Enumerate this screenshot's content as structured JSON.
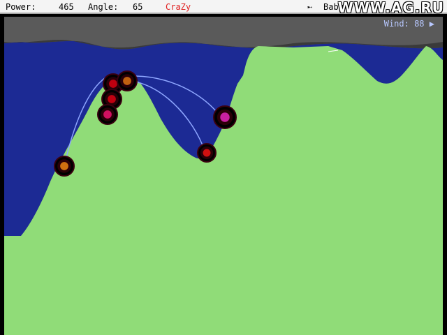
{
  "hud": {
    "power_label": "Power:",
    "power_value": "465",
    "angle_label": "Angle:",
    "angle_value": "65",
    "player_name": "CraZy",
    "weapon_icon": "missile-icon",
    "weapon_name": "Baby",
    "watermark": "WWW.AG.RU"
  },
  "wind": {
    "label": "Wind:",
    "value": "88",
    "direction_icon": "arrow-right-icon"
  },
  "colors": {
    "ground": "#90dc78",
    "sky": "#1c2a94",
    "rock": "#585858",
    "hud_bg": "#f4f4f4",
    "player_text": "#e02020"
  },
  "tanks": [
    {
      "name": "tank-orange",
      "color": "#d07010"
    },
    {
      "name": "tank-red-top",
      "color": "#c00010"
    },
    {
      "name": "tank-orange-top",
      "color": "#c06010"
    },
    {
      "name": "tank-magenta-left",
      "color": "#d01060"
    },
    {
      "name": "tank-magenta-right",
      "color": "#c820a0"
    },
    {
      "name": "tank-red-valley",
      "color": "#d01010"
    }
  ]
}
